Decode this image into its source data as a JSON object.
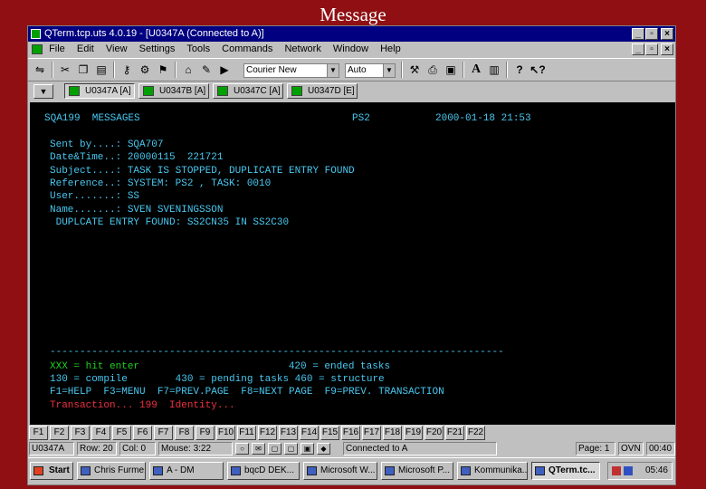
{
  "slide": {
    "title": "Message"
  },
  "window": {
    "title": "QTerm.tcp.uts 4.0.19 - [U0347A (Connected to A)]",
    "controls": {
      "minimize": "_",
      "restore": "▫",
      "close": "×"
    }
  },
  "menu": [
    "File",
    "Edit",
    "View",
    "Settings",
    "Tools",
    "Commands",
    "Network",
    "Window",
    "Help"
  ],
  "toolbar": {
    "font_combo": "Courier New",
    "size_combo": "Auto",
    "font_button": "A"
  },
  "sessions": [
    {
      "label": "U0347A [A]"
    },
    {
      "label": "U0347B [A]"
    },
    {
      "label": "U0347C [A]"
    },
    {
      "label": "U0347D [E]"
    }
  ],
  "terminal": {
    "header_left": "SQA199  MESSAGES",
    "header_mid": "PS2",
    "header_right": "2000-01-18 21:53",
    "fields": [
      "Sent by....: SQA707",
      "Date&Time..: 20000115  221721",
      "Subject....: TASK IS STOPPED, DUPLICATE ENTRY FOUND",
      "Reference..: SYSTEM: PS2 , TASK: 0010",
      "User.......: SS",
      "Name.......: SVEN SVENINGSSON",
      " DUPLCATE ENTRY FOUND: SS2CN35 IN SS2C30"
    ],
    "separator": "----------------------------------------------------------------------------",
    "help1_green": "XXX = hit enter",
    "help1_rest": "                       420 = ended tasks",
    "help2": "130 = compile        430 = pending tasks 460 = structure",
    "help3": "F1=HELP  F3=MENU  F7=PREV.PAGE  F8=NEXT PAGE  F9=PREV. TRANSACTION",
    "transaction": "Transaction... 199  Identity..."
  },
  "fkeys": [
    "F1",
    "F2",
    "F3",
    "F4",
    "F5",
    "F6",
    "F7",
    "F8",
    "F9",
    "F10",
    "F11",
    "F12",
    "F13",
    "F14",
    "F15",
    "F16",
    "F17",
    "F18",
    "F19",
    "F20",
    "F21",
    "F22"
  ],
  "status": {
    "session": "U0347A",
    "row": "Row: 20",
    "col": "Col: 0",
    "mouse": "Mouse: 3:22",
    "connection": "Connected to A",
    "page": "Page: 1",
    "ovn": "OVN",
    "time": "00:40"
  },
  "taskbar": {
    "start": "Start",
    "items": [
      "Chris Furme...",
      "A - DM",
      "bqcD DEK...",
      "Microsoft W...",
      "Microsoft P...",
      "Kommunika...",
      "QTerm.tc..."
    ],
    "clock": "05:46"
  }
}
